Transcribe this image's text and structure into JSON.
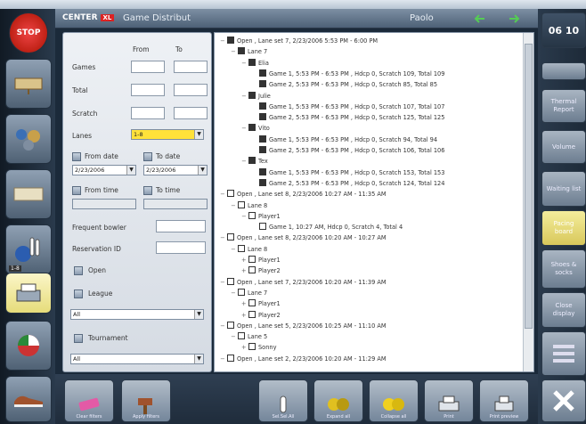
{
  "header": {
    "logo": "CENTER",
    "logo_tag": "XL",
    "title": "Game Distribut",
    "user": "Paolo",
    "clock": "06 10",
    "clock_sub": ""
  },
  "filters": {
    "col_from": "From",
    "col_to": "To",
    "games_label": "Games",
    "total_label": "Total",
    "scratch_label": "Scratch",
    "lanes_label": "Lanes",
    "lanes_value": "1-8",
    "from_date_label": "From date",
    "to_date_label": "To date",
    "from_date_value": "2/23/2006",
    "to_date_value": "2/23/2006",
    "from_time_label": "From time",
    "to_time_label": "To time",
    "frequent_bowler_label": "Frequent bowler",
    "reservation_id_label": "Reservation ID",
    "open_label": "Open",
    "league_label": "League",
    "league_value": "All",
    "tournament_label": "Tournament",
    "tournament_value": "All"
  },
  "tree": {
    "rows": [
      {
        "indent": 0,
        "exp": "−",
        "box": "dark",
        "text": "Open , Lane set 7, 2/23/2006 5:53 PM - 6:00 PM"
      },
      {
        "indent": 1,
        "exp": "−",
        "box": "dark",
        "text": "Lane 7"
      },
      {
        "indent": 2,
        "exp": "−",
        "box": "dark",
        "text": "Elia"
      },
      {
        "indent": 3,
        "exp": "",
        "box": "dark",
        "text": "Game 1, 5:53 PM - 6:53 PM , Hdcp 0, Scratch 109, Total 109"
      },
      {
        "indent": 3,
        "exp": "",
        "box": "dark",
        "text": "Game 2, 5:53 PM - 6:53 PM , Hdcp 0, Scratch 85, Total 85"
      },
      {
        "indent": 2,
        "exp": "−",
        "box": "dark",
        "text": "Julie"
      },
      {
        "indent": 3,
        "exp": "",
        "box": "dark",
        "text": "Game 1, 5:53 PM - 6:53 PM , Hdcp 0, Scratch 107, Total 107"
      },
      {
        "indent": 3,
        "exp": "",
        "box": "dark",
        "text": "Game 2, 5:53 PM - 6:53 PM , Hdcp 0, Scratch 125, Total 125"
      },
      {
        "indent": 2,
        "exp": "−",
        "box": "dark",
        "text": "Vito"
      },
      {
        "indent": 3,
        "exp": "",
        "box": "dark",
        "text": "Game 1, 5:53 PM - 6:53 PM , Hdcp 0, Scratch 94, Total 94"
      },
      {
        "indent": 3,
        "exp": "",
        "box": "dark",
        "text": "Game 2, 5:53 PM - 6:53 PM , Hdcp 0, Scratch 106, Total 106"
      },
      {
        "indent": 2,
        "exp": "−",
        "box": "dark",
        "text": "Tex"
      },
      {
        "indent": 3,
        "exp": "",
        "box": "dark",
        "text": "Game 1, 5:53 PM - 6:53 PM , Hdcp 0, Scratch 153, Total 153"
      },
      {
        "indent": 3,
        "exp": "",
        "box": "dark",
        "text": "Game 2, 5:53 PM - 6:53 PM , Hdcp 0, Scratch 124, Total 124"
      },
      {
        "indent": 0,
        "exp": "−",
        "box": "",
        "text": "Open , Lane set 8, 2/23/2006 10:27 AM - 11:35 AM"
      },
      {
        "indent": 1,
        "exp": "−",
        "box": "",
        "text": "Lane 8"
      },
      {
        "indent": 2,
        "exp": "−",
        "box": "",
        "text": "Player1"
      },
      {
        "indent": 3,
        "exp": "",
        "box": "",
        "text": "Game 1, 10:27 AM, Hdcp 0, Scratch 4, Total 4"
      },
      {
        "indent": 0,
        "exp": "−",
        "box": "",
        "text": "Open , Lane set 8, 2/23/2006 10:20 AM - 10:27 AM"
      },
      {
        "indent": 1,
        "exp": "−",
        "box": "",
        "text": "Lane 8"
      },
      {
        "indent": 2,
        "exp": "+",
        "box": "",
        "text": "Player1"
      },
      {
        "indent": 2,
        "exp": "+",
        "box": "",
        "text": "Player2"
      },
      {
        "indent": 0,
        "exp": "−",
        "box": "",
        "text": "Open , Lane set 7, 2/23/2006 10:20 AM - 11:39 AM"
      },
      {
        "indent": 1,
        "exp": "−",
        "box": "",
        "text": "Lane 7"
      },
      {
        "indent": 2,
        "exp": "+",
        "box": "",
        "text": "Player1"
      },
      {
        "indent": 2,
        "exp": "+",
        "box": "",
        "text": "Player2"
      },
      {
        "indent": 0,
        "exp": "−",
        "box": "",
        "text": "Open , Lane set 5, 2/23/2006 10:25 AM - 11:10 AM"
      },
      {
        "indent": 1,
        "exp": "−",
        "box": "",
        "text": "Lane 5"
      },
      {
        "indent": 2,
        "exp": "+",
        "box": "",
        "text": "Sonny"
      },
      {
        "indent": 0,
        "exp": "−",
        "box": "",
        "text": "Open , Lane set 2, 2/23/2006 10:20 AM - 11:29 AM"
      }
    ]
  },
  "right": {
    "b1": "",
    "b2": "Thermal Report",
    "b3": "Volume",
    "b4": "Waiting list",
    "b5": "Pacing board",
    "b6": "Shoes & socks",
    "b7": "Close display"
  },
  "bottom": {
    "clear": "Clear filters",
    "apply": "Apply filters",
    "select_all": "Sel.Sel.All",
    "expand_all": "Expand all",
    "collapse_all": "Collapse all",
    "print": "Print",
    "print_preview": "Print preview"
  },
  "left": {
    "stop": "STOP",
    "badge": "1-8"
  }
}
